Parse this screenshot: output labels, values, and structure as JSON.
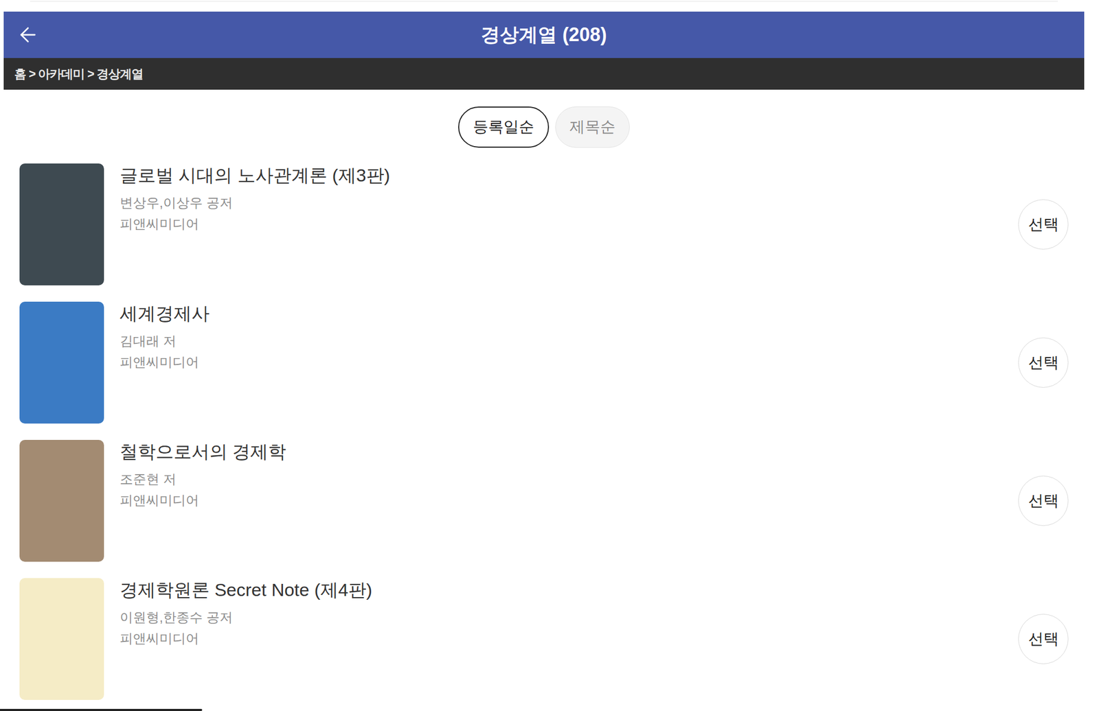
{
  "header": {
    "title": "경상계열 (208)",
    "back": true
  },
  "breadcrumb": "홈 > 아카데미 > 경상계열",
  "sort_tabs": [
    {
      "label": "등록일순",
      "selected": true
    },
    {
      "label": "제목순",
      "selected": false
    }
  ],
  "books": [
    {
      "title": "글로벌 시대의 노사관계론 (제3판)",
      "author": "변상우,이상우 공저",
      "publisher": "피앤씨미디어",
      "color": "#3e4a51",
      "button": "선택"
    },
    {
      "title": "세계경제사",
      "author": "김대래 저",
      "publisher": "피앤씨미디어",
      "color": "#3b7bc4",
      "button": "선택"
    },
    {
      "title": "철학으로서의 경제학",
      "author": "조준현 저",
      "publisher": "피앤씨미디어",
      "color": "#a38b72",
      "button": "선택"
    },
    {
      "title": "경제학원론 Secret Note (제4판)",
      "author": "이원형,한종수 공저",
      "publisher": "피앤씨미디어",
      "color": "#f5ecc6",
      "button": "선택"
    }
  ]
}
